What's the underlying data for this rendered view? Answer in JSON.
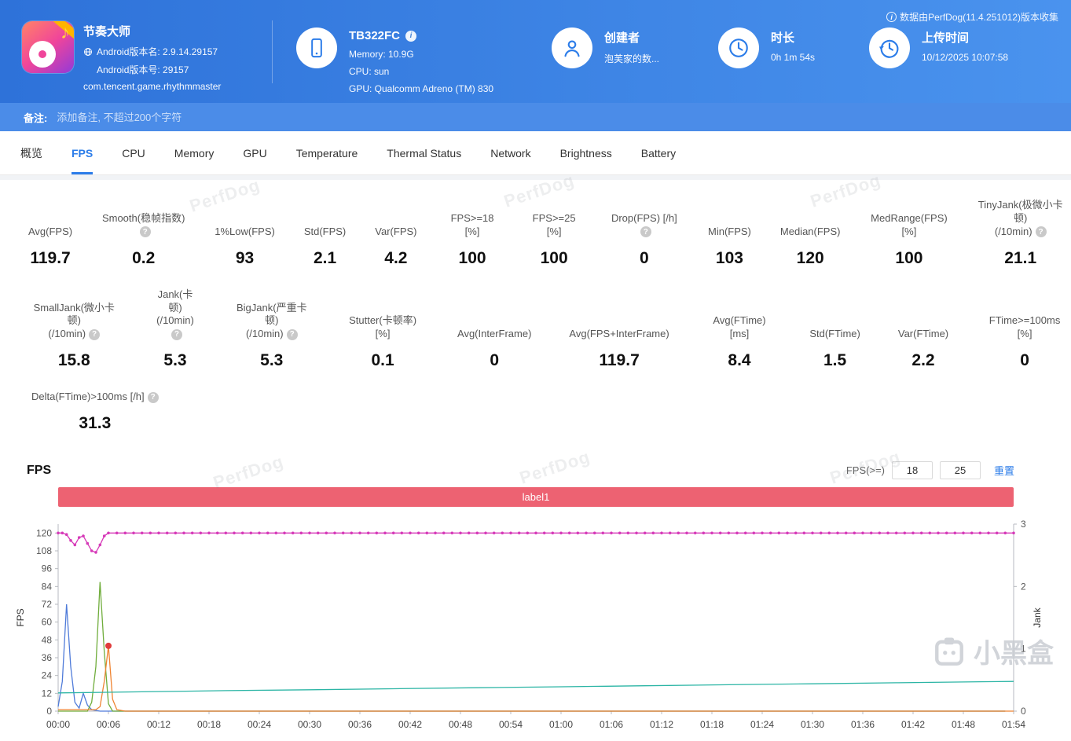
{
  "colors": {
    "header_blue_start": "#2e72d9",
    "header_blue_end": "#4a93ee",
    "note_bar_blue": "#4b8ce8",
    "accent_blue": "#2b7ce9",
    "banner_red": "#ed6272",
    "link_blue": "#2b7ce9"
  },
  "header": {
    "collect_note": "数据由PerfDog(11.4.251012)版本收集",
    "app": {
      "name": "节奏大师",
      "version_name": "Android版本名: 2.9.14.29157",
      "version_code": "Android版本号: 29157",
      "package": "com.tencent.game.rhythmmaster"
    },
    "device": {
      "model": "TB322FC",
      "memory": "Memory: 10.9G",
      "cpu": "CPU: sun",
      "gpu": "GPU: Qualcomm Adreno (TM) 830"
    },
    "creator": {
      "label": "创建者",
      "value": "泡芙家的数..."
    },
    "duration": {
      "label": "时长",
      "value": "0h 1m 54s"
    },
    "upload": {
      "label": "上传时间",
      "value": "10/12/2025 10:07:58"
    }
  },
  "note_bar": {
    "label": "备注:",
    "placeholder": "添加备注, 不超过200个字符"
  },
  "tabs": {
    "labels": [
      "概览",
      "FPS",
      "CPU",
      "Memory",
      "GPU",
      "Temperature",
      "Thermal Status",
      "Network",
      "Brightness",
      "Battery"
    ],
    "active": "FPS"
  },
  "stats": {
    "rows": [
      [
        {
          "key": "avg-fps",
          "label": "Avg(FPS)",
          "value": "119.7"
        },
        {
          "key": "smooth",
          "label": "Smooth(稳帧指数)",
          "value": "0.2",
          "help": true
        },
        {
          "key": "low1-fps",
          "label": "1%Low(FPS)",
          "value": "93"
        },
        {
          "key": "std-fps",
          "label": "Std(FPS)",
          "value": "2.1"
        },
        {
          "key": "var-fps",
          "label": "Var(FPS)",
          "value": "4.2"
        },
        {
          "key": "fps-ge-18",
          "label": "FPS>=18 [%]",
          "value": "100"
        },
        {
          "key": "fps-ge-25",
          "label": "FPS>=25 [%]",
          "value": "100"
        },
        {
          "key": "drop-fps",
          "label": "Drop(FPS) [/h]",
          "value": "0",
          "help": true
        },
        {
          "key": "min-fps",
          "label": "Min(FPS)",
          "value": "103"
        },
        {
          "key": "median-fps",
          "label": "Median(FPS)",
          "value": "120"
        },
        {
          "key": "medrange-fps",
          "label": "MedRange(FPS)[%]",
          "value": "100"
        },
        {
          "key": "tinyjank",
          "label": "TinyJank(极微小卡顿)\n(/10min)",
          "value": "21.1",
          "help": true
        }
      ],
      [
        {
          "key": "smalljank",
          "label": "SmallJank(微小卡顿)\n(/10min)",
          "value": "15.8",
          "help": true
        },
        {
          "key": "jank",
          "label": "Jank(卡顿)\n(/10min)",
          "value": "5.3",
          "help": true
        },
        {
          "key": "bigjank",
          "label": "BigJank(严重卡顿)\n(/10min)",
          "value": "5.3",
          "help": true
        },
        {
          "key": "stutter",
          "label": "Stutter(卡顿率) [%]",
          "value": "0.1"
        },
        {
          "key": "avg-interframe",
          "label": "Avg(InterFrame)",
          "value": "0"
        },
        {
          "key": "avg-fps-interframe",
          "label": "Avg(FPS+InterFrame)",
          "value": "119.7"
        },
        {
          "key": "avg-ftime",
          "label": "Avg(FTime) [ms]",
          "value": "8.4"
        },
        {
          "key": "std-ftime",
          "label": "Std(FTime)",
          "value": "1.5"
        },
        {
          "key": "var-ftime",
          "label": "Var(FTime)",
          "value": "2.2"
        },
        {
          "key": "ftime-ge-100",
          "label": "FTime>=100ms [%]",
          "value": "0"
        }
      ],
      [
        {
          "key": "delta-ftime",
          "label": "Delta(FTime)>100ms [/h]",
          "value": "31.3",
          "help": true
        }
      ]
    ]
  },
  "fps_section": {
    "title": "FPS",
    "filter_label": "FPS(>=)",
    "threshold_low": "18",
    "threshold_high": "25",
    "reset_label": "重置",
    "banner_label": "label1"
  },
  "chart_data": {
    "type": "line",
    "title": "FPS",
    "x_axis": {
      "tick_interval_seconds": 6,
      "max_seconds": 114,
      "tick_labels": [
        "00:00",
        "00:06",
        "00:12",
        "00:18",
        "00:24",
        "00:30",
        "00:36",
        "00:42",
        "00:48",
        "00:54",
        "01:00",
        "01:06",
        "01:12",
        "01:18",
        "01:24",
        "01:30",
        "01:36",
        "01:42",
        "01:48",
        "01:54"
      ]
    },
    "left_axis": {
      "label": "FPS",
      "ticks": [
        0,
        12,
        24,
        36,
        48,
        60,
        72,
        84,
        96,
        108,
        120
      ],
      "max": 126
    },
    "right_axis": {
      "label": "Jank",
      "ticks": [
        0,
        1,
        2,
        3
      ],
      "max": 3
    },
    "series": [
      {
        "name": "fps-magenta",
        "color": "#d63ab8",
        "axis": "left",
        "marker": true,
        "points": [
          [
            0,
            120
          ],
          [
            0.5,
            120
          ],
          [
            1,
            119
          ],
          [
            1.5,
            115
          ],
          [
            2,
            112
          ],
          [
            2.5,
            117
          ],
          [
            3,
            118
          ],
          [
            3.5,
            113
          ],
          [
            4,
            108
          ],
          [
            4.5,
            107
          ],
          [
            5,
            112
          ],
          [
            5.5,
            118
          ],
          [
            6,
            120
          ]
        ],
        "extend": {
          "from": 7,
          "to": 114,
          "step": 1,
          "value": 120
        }
      },
      {
        "name": "spike-blue",
        "color": "#4f7bd9",
        "axis": "left",
        "marker": false,
        "points": [
          [
            0,
            3
          ],
          [
            0.5,
            20
          ],
          [
            1,
            72
          ],
          [
            1.5,
            30
          ],
          [
            2,
            6
          ],
          [
            2.5,
            2
          ],
          [
            3,
            12
          ],
          [
            3.5,
            4
          ],
          [
            4,
            1
          ],
          [
            5,
            0
          ]
        ],
        "extend": {
          "from": 8,
          "to": 114,
          "step": 3,
          "value": 0
        }
      },
      {
        "name": "spike-green",
        "color": "#70ad3c",
        "axis": "left",
        "marker": false,
        "points": [
          [
            0,
            0
          ],
          [
            3.5,
            0
          ],
          [
            4,
            6
          ],
          [
            4.5,
            30
          ],
          [
            5,
            87
          ],
          [
            5.5,
            40
          ],
          [
            6,
            5
          ],
          [
            6.5,
            0
          ]
        ],
        "extend": {
          "from": 8,
          "to": 114,
          "step": 3,
          "value": 0
        }
      },
      {
        "name": "spike-orange",
        "color": "#ef8432",
        "axis": "left",
        "marker": false,
        "points": [
          [
            0,
            1
          ],
          [
            4.5,
            1
          ],
          [
            5,
            3
          ],
          [
            5.5,
            20
          ],
          [
            6,
            44
          ],
          [
            6.5,
            8
          ],
          [
            7,
            1
          ],
          [
            8,
            0
          ]
        ],
        "extend": {
          "from": 9,
          "to": 114,
          "step": 3,
          "value": 0
        }
      },
      {
        "name": "rising-teal",
        "color": "#2cb5a5",
        "axis": "left",
        "marker": false,
        "points": [
          [
            0,
            12.3
          ],
          [
            10,
            13
          ],
          [
            20,
            13.8
          ],
          [
            30,
            14.4
          ],
          [
            40,
            15.1
          ],
          [
            50,
            15.8
          ],
          [
            60,
            16.4
          ],
          [
            70,
            17.1
          ],
          [
            80,
            17.8
          ],
          [
            90,
            18.4
          ],
          [
            100,
            19.1
          ],
          [
            110,
            19.8
          ],
          [
            114,
            20
          ]
        ]
      }
    ],
    "point_markers": [
      {
        "x": 6,
        "y": 44,
        "color": "#e03c3c"
      }
    ]
  },
  "watermark": {
    "text": "PerfDog",
    "brand": "小黑盒"
  }
}
